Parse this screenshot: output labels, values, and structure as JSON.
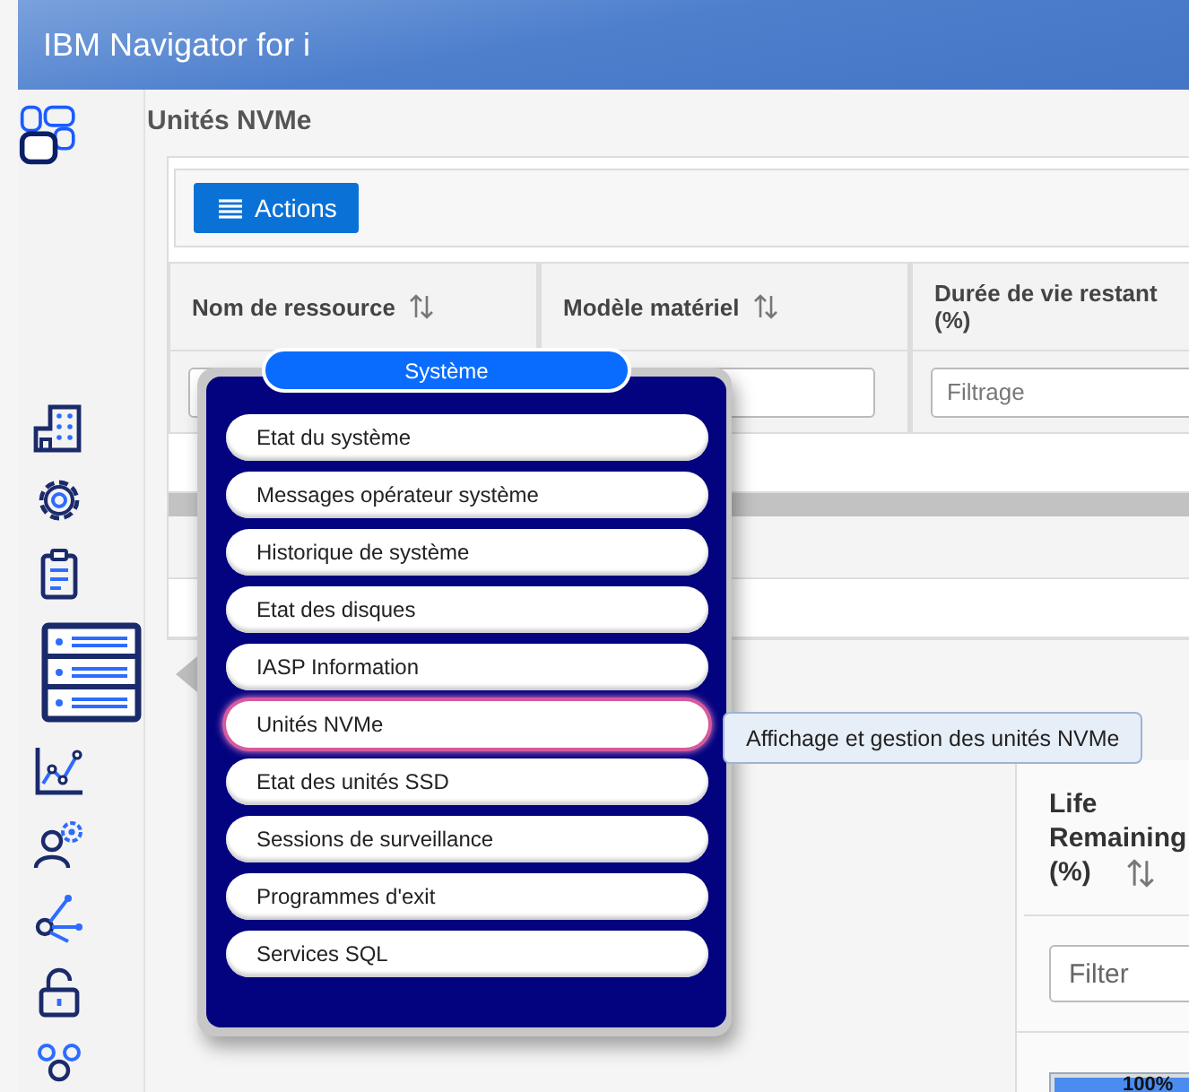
{
  "header": {
    "title": "IBM Navigator for i"
  },
  "sidebar": {
    "items": [
      {
        "kind": "building",
        "selected": false
      },
      {
        "kind": "gear",
        "selected": false
      },
      {
        "kind": "clipboard",
        "selected": false
      },
      {
        "kind": "server",
        "selected": true
      },
      {
        "kind": "chart",
        "selected": false
      },
      {
        "kind": "user-gear",
        "selected": false
      },
      {
        "kind": "network",
        "selected": false
      },
      {
        "kind": "lock",
        "selected": false
      },
      {
        "kind": "people",
        "selected": false
      }
    ]
  },
  "page": {
    "title": "Unités NVMe",
    "actions_button": "Actions",
    "table": {
      "columns": [
        {
          "label": "Nom de ressource",
          "sortable": true
        },
        {
          "label": "Modèle matériel",
          "sortable": true
        },
        {
          "label": "Durée de vie restant (%)",
          "sortable": false,
          "filter_placeholder": "Filtrage"
        }
      ]
    }
  },
  "menu": {
    "title": "Système",
    "items": [
      {
        "label": "Etat du système",
        "selected": false
      },
      {
        "label": "Messages opérateur système",
        "selected": false
      },
      {
        "label": "Historique de système",
        "selected": false
      },
      {
        "label": "Etat des disques",
        "selected": false
      },
      {
        "label": "IASP Information",
        "selected": false
      },
      {
        "label": "Unités NVMe",
        "selected": true
      },
      {
        "label": "Etat des unités SSD",
        "selected": false
      },
      {
        "label": "Sessions de surveillance",
        "selected": false
      },
      {
        "label": "Programmes d'exit",
        "selected": false
      },
      {
        "label": "Services SQL",
        "selected": false
      }
    ]
  },
  "tooltip": {
    "text": "Affichage et gestion des unités NVMe"
  },
  "inset": {
    "column": {
      "label": "Life Remaining (%)",
      "sortable": true
    },
    "filter_placeholder": "Filter",
    "bar": {
      "level": 1,
      "reading": "100%"
    }
  }
}
